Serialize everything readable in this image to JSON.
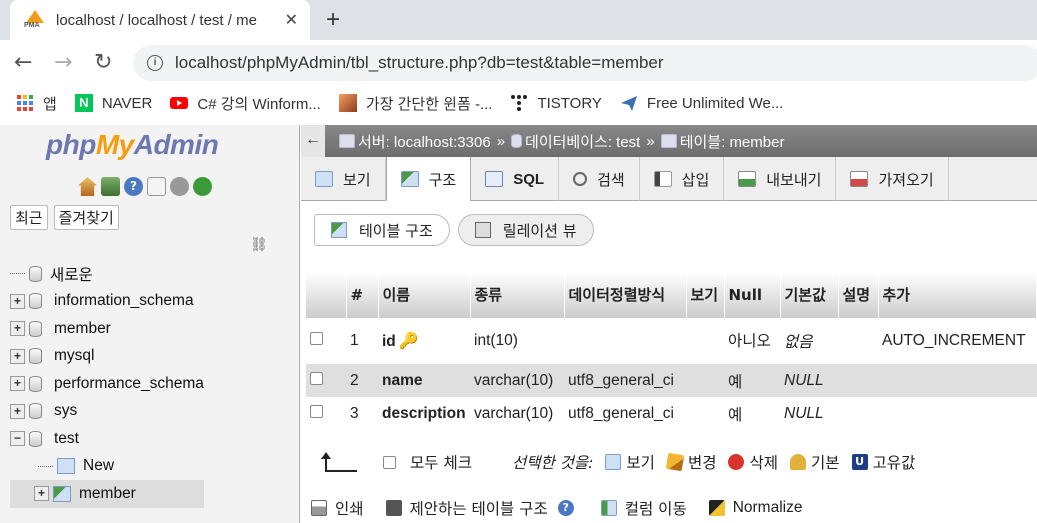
{
  "browser": {
    "tab_title": "localhost / localhost / test / me",
    "tab_close": "✕",
    "new_tab": "+",
    "url": "localhost/phpMyAdmin/tbl_structure.php?db=test&table=member",
    "bookmarks": [
      {
        "label": "앱",
        "icon": "apps-grid-icon",
        "color": "#ea4335"
      },
      {
        "label": "NAVER",
        "icon": "naver-icon",
        "color": "#03c75a"
      },
      {
        "label": "C# 강의 Winform...",
        "icon": "youtube-icon",
        "color": "#ff0000"
      },
      {
        "label": "가장 간단한 윈폼 -...",
        "icon": "blog-thumbnail-icon",
        "color": "#d2691e"
      },
      {
        "label": "TISTORY",
        "icon": "tistory-icon",
        "color": "#222222"
      },
      {
        "label": "Free Unlimited We...",
        "icon": "plane-icon",
        "color": "#3a6fb0"
      }
    ]
  },
  "left": {
    "logo": {
      "php": "php",
      "my": "My",
      "admin": "Admin"
    },
    "recent_label": "최근",
    "favorites_label": "즐겨찾기",
    "tree": [
      {
        "label": "새로운",
        "type": "new"
      },
      {
        "label": "information_schema",
        "type": "db"
      },
      {
        "label": "member",
        "type": "db"
      },
      {
        "label": "mysql",
        "type": "db"
      },
      {
        "label": "performance_schema",
        "type": "db"
      },
      {
        "label": "sys",
        "type": "db"
      },
      {
        "label": "test",
        "type": "db-open"
      },
      {
        "label": "New",
        "type": "sub-new"
      },
      {
        "label": "member",
        "type": "sub-table"
      }
    ]
  },
  "breadcrumb": {
    "back": "←",
    "server": "서버: localhost:3306",
    "database": "데이터베이스: test",
    "table": "테이블: member",
    "sep": "»"
  },
  "tabs": [
    "보기",
    "구조",
    "SQL",
    "검색",
    "삽입",
    "내보내기",
    "가져오기"
  ],
  "active_tab": "구조",
  "subtabs": {
    "structure": "테이블 구조",
    "relation": "릴레이션 뷰"
  },
  "table": {
    "headers": {
      "num": "#",
      "name": "이름",
      "type": "종류",
      "collation": "데이터정렬방식",
      "attributes": "보기",
      "null": "Null",
      "default": "기본값",
      "comment": "설명",
      "extra": "추가"
    },
    "rows": [
      {
        "num": "1",
        "name": "id",
        "type": "int(10)",
        "collation": "",
        "null": "아니오",
        "default": "없음",
        "extra": "AUTO_INCREMENT",
        "primary": true
      },
      {
        "num": "2",
        "name": "name",
        "type": "varchar(10)",
        "collation": "utf8_general_ci",
        "null": "예",
        "default": "NULL",
        "extra": ""
      },
      {
        "num": "3",
        "name": "description",
        "type": "varchar(10)",
        "collation": "utf8_general_ci",
        "null": "예",
        "default": "NULL",
        "extra": ""
      }
    ]
  },
  "actions": {
    "check_all": "모두 체크",
    "with_selected": "선택한 것을:",
    "browse": "보기",
    "change": "변경",
    "drop": "삭제",
    "primary": "기본",
    "unique": "고유값"
  },
  "bottom": {
    "print": "인쇄",
    "propose": "제안하는 테이블 구조",
    "move_columns": "컬럼 이동",
    "normalize": "Normalize"
  }
}
